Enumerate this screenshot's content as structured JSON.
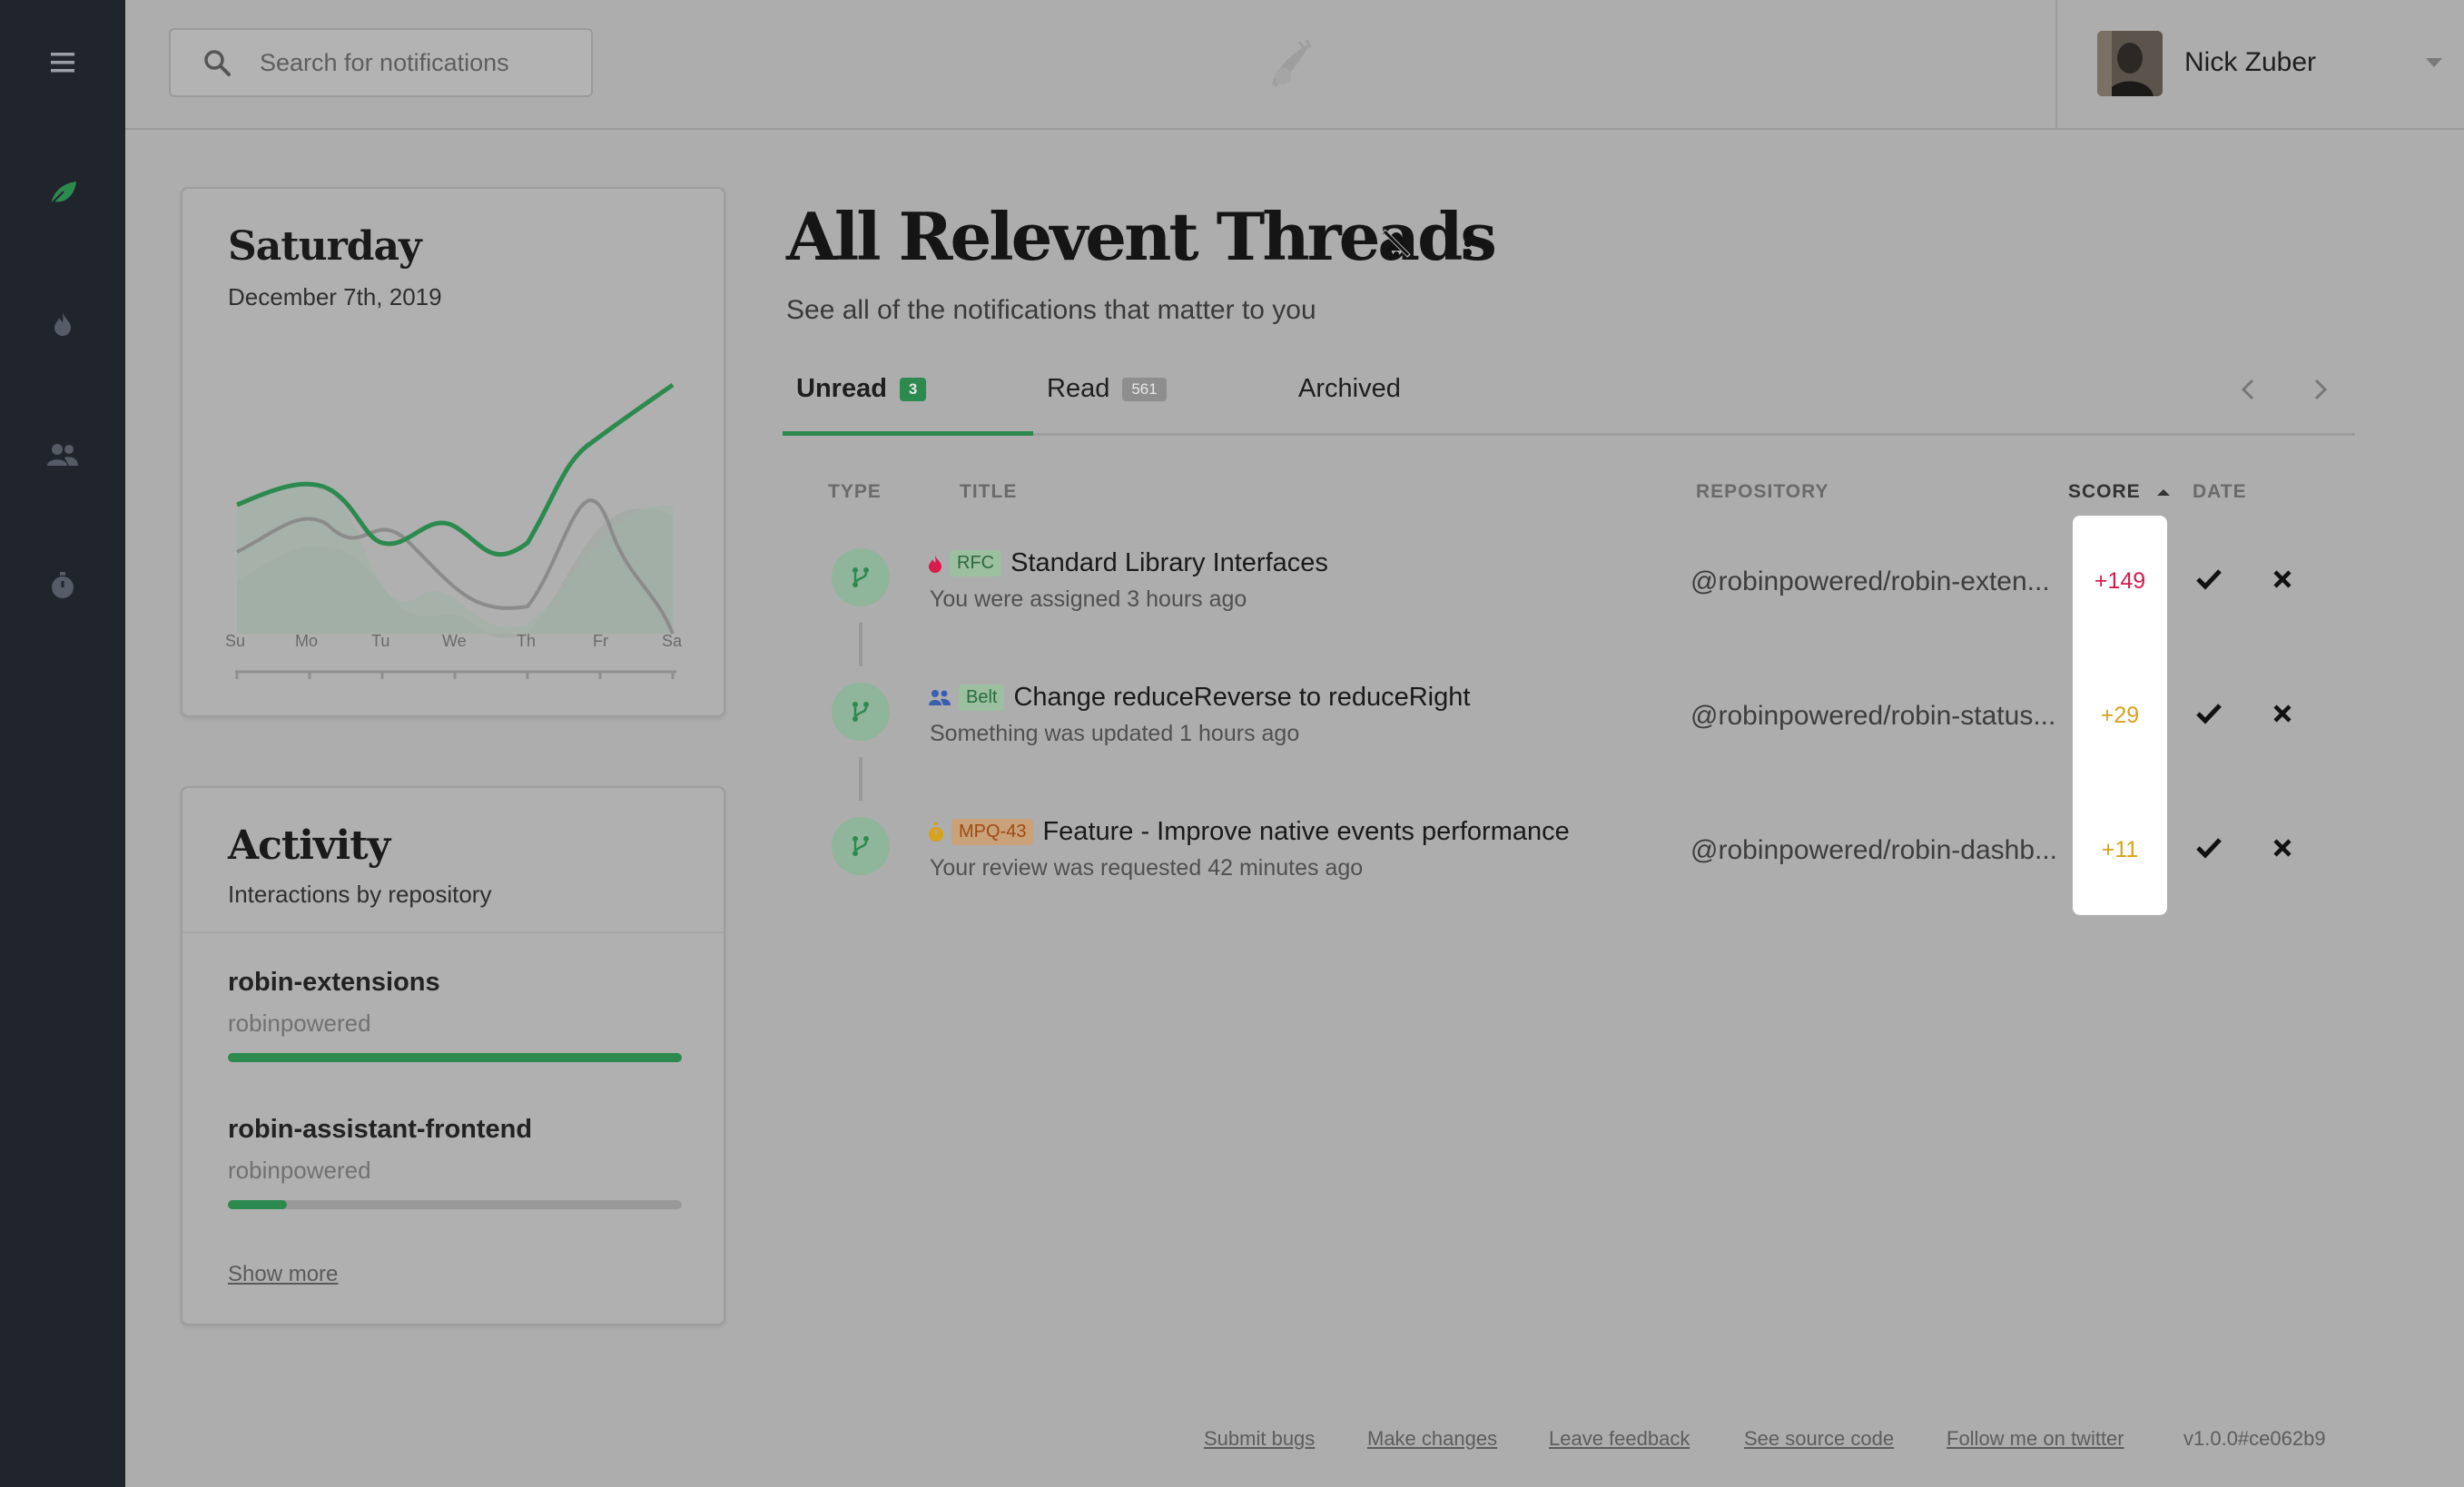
{
  "search": {
    "placeholder": "Search for notifications"
  },
  "user": {
    "name": "Nick Zuber"
  },
  "day_card": {
    "title": "Saturday",
    "date": "December 7th, 2019",
    "days": [
      "Su",
      "Mo",
      "Tu",
      "We",
      "Th",
      "Fr",
      "Sa"
    ]
  },
  "activity": {
    "title": "Activity",
    "subtitle": "Interactions by repository",
    "repos": [
      {
        "name": "robin-extensions",
        "owner": "robinpowered",
        "share": 1.0
      },
      {
        "name": "robin-assistant-frontend",
        "owner": "robinpowered",
        "share": 0.13
      }
    ],
    "show_more": "Show more"
  },
  "main": {
    "title": "All Relevent Threads",
    "subtitle": "See all of the notifications that matter to you",
    "tabs": [
      {
        "label": "Unread",
        "count": "3"
      },
      {
        "label": "Read",
        "count": "561"
      },
      {
        "label": "Archived"
      }
    ],
    "headers": {
      "type": "TYPE",
      "title": "TITLE",
      "repository": "REPOSITORY",
      "score": "SCORE",
      "date": "DATE"
    },
    "rows": [
      {
        "tag": "RFC",
        "title": "Standard Library Interfaces",
        "sub": "You were assigned 3 hours ago",
        "repo": "@robinpowered/robin-exten...",
        "score": "+149",
        "score_color": "#d81b4a"
      },
      {
        "tag": "Belt",
        "title": "Change reduceReverse to reduceRight",
        "sub": "Something was updated 1 hours ago",
        "repo": "@robinpowered/robin-status...",
        "score": "+29",
        "score_color": "#d9a21b"
      },
      {
        "tag": "MPQ-43",
        "title": "Feature - Improve native events performance",
        "sub": "Your review was requested 42 minutes ago",
        "repo": "@robinpowered/robin-dashb...",
        "score": "+11",
        "score_color": "#d9a21b"
      }
    ]
  },
  "footer": {
    "links": [
      "Submit bugs",
      "Make changes",
      "Leave feedback",
      "See source code",
      "Follow me on twitter"
    ],
    "version": "v1.0.0#ce062b9"
  },
  "colors": {
    "accent": "#2d8a4e",
    "sidebar": "#20242b"
  }
}
